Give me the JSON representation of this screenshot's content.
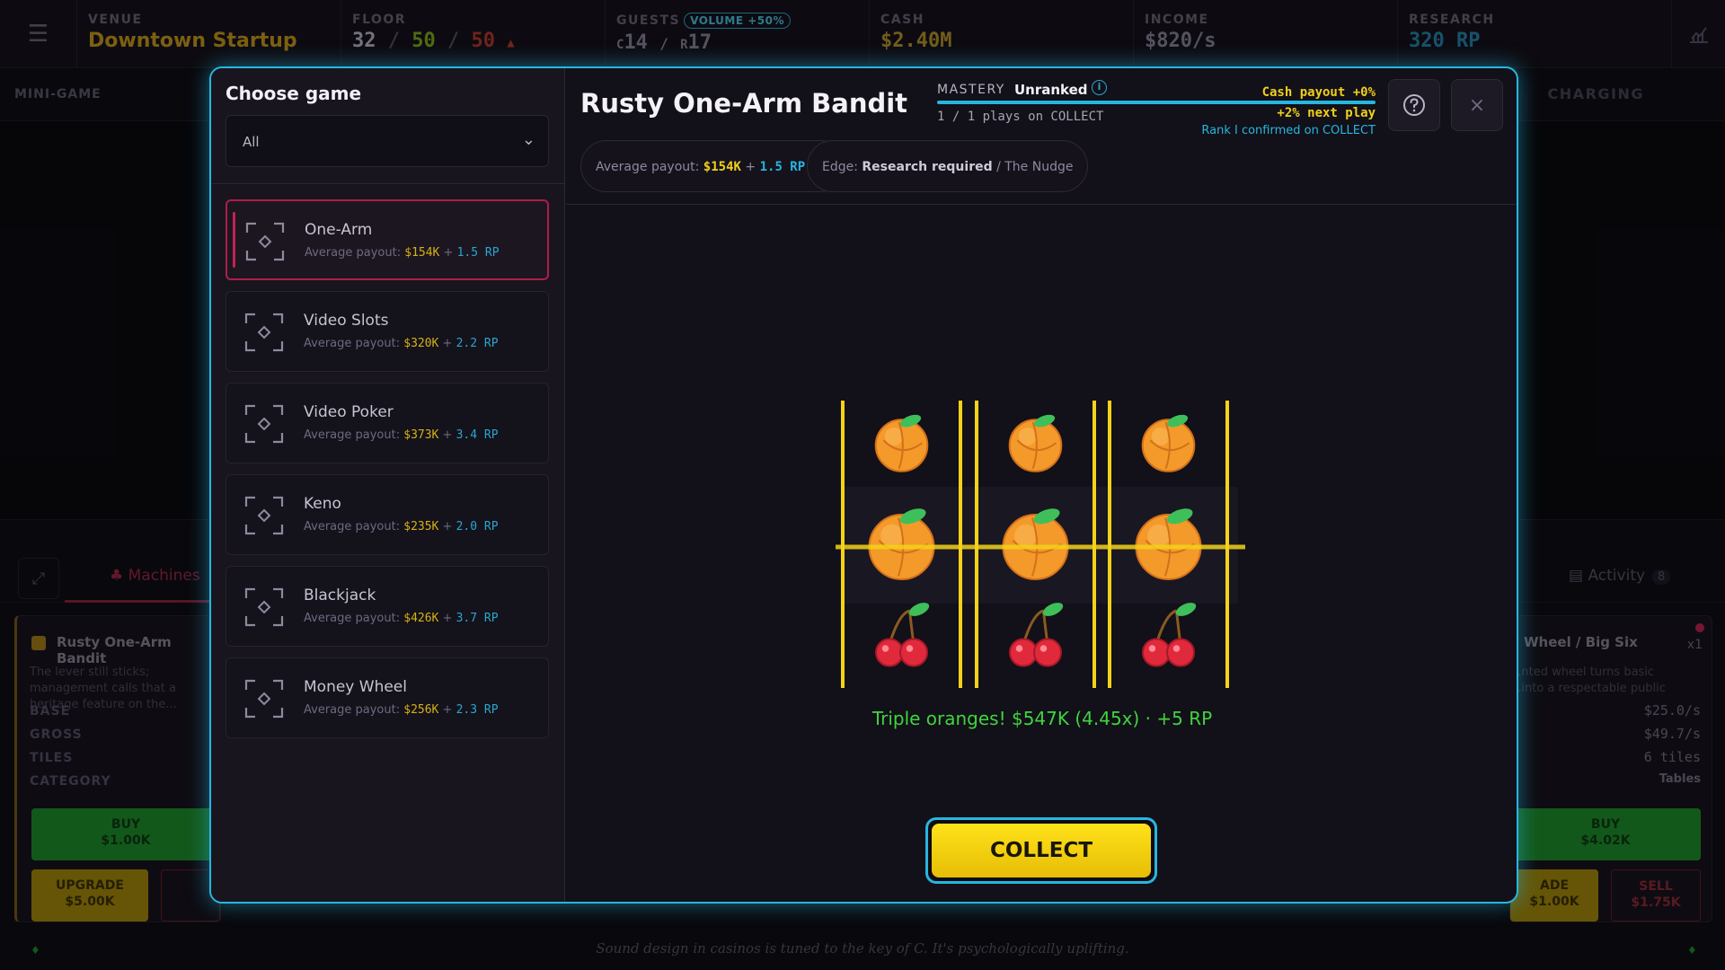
{
  "topbar": {
    "venue_label": "VENUE",
    "venue_name": "Downtown Startup",
    "floor_label": "FLOOR",
    "floor_used": "32",
    "floor_mid": "50",
    "floor_max": "50",
    "guests_label": "GUESTS",
    "guests_chip": "VOLUME +50%",
    "guests_c_label": "C",
    "guests_c": "14",
    "guests_r_label": "R",
    "guests_r": "17",
    "cash_label": "CASH",
    "cash_value": "$2.40M",
    "income_label": "INCOME",
    "income_value": "$820/s",
    "research_label": "RESEARCH",
    "research_value": "320 RP"
  },
  "subbar": {
    "left": "MINI-GAME",
    "right": "CHARGING"
  },
  "bottom": {
    "tab_machines": "Machines",
    "tab_activity": "Activity",
    "activity_count": "8",
    "left_card": {
      "title": "Rusty One-Arm Bandit",
      "desc": "The lever still sticks; management calls that a heritage feature on the...",
      "base": "BASE",
      "gross": "GROSS",
      "tiles": "TILES",
      "category": "CATEGORY",
      "buy": "BUY",
      "buy_price": "$1.00K",
      "upgrade": "UPGRADE",
      "upgrade_price": "$5.00K"
    },
    "right_card": {
      "title": "y Wheel / Big Six",
      "count": "x1",
      "desc": "...nted wheel turns basic ...into a respectable public",
      "v1": "$25.0/s",
      "v2": "$49.7/s",
      "v3": "6 tiles",
      "v4": "Tables",
      "buy": "BUY",
      "buy_price": "$4.02K",
      "upgrade": "ADE",
      "upgrade_price": "$1.00K",
      "sell": "SELL",
      "sell_price": "$1.75K"
    },
    "tip": "Sound design in casinos is tuned to the key of C. It's psychologically uplifting."
  },
  "modal": {
    "side_title": "Choose game",
    "filter_value": "All",
    "games": [
      {
        "name": "One-Arm",
        "payout_label": "Average payout:",
        "cash": "$154K",
        "plus": "+",
        "rp": "1.5 RP"
      },
      {
        "name": "Video Slots",
        "payout_label": "Average payout:",
        "cash": "$320K",
        "plus": "+",
        "rp": "2.2 RP"
      },
      {
        "name": "Video Poker",
        "payout_label": "Average payout:",
        "cash": "$373K",
        "plus": "+",
        "rp": "3.4 RP"
      },
      {
        "name": "Keno",
        "payout_label": "Average payout:",
        "cash": "$235K",
        "plus": "+",
        "rp": "2.0 RP"
      },
      {
        "name": "Blackjack",
        "payout_label": "Average payout:",
        "cash": "$426K",
        "plus": "+",
        "rp": "3.7 RP"
      },
      {
        "name": "Money Wheel",
        "payout_label": "Average payout:",
        "cash": "$256K",
        "plus": "+",
        "rp": "2.3 RP"
      }
    ],
    "title": "Rusty One-Arm Bandit",
    "mastery_label": "MASTERY",
    "mastery_rank": "Unranked",
    "mastery_progress": 1.0,
    "plays": "1 / 1 plays on COLLECT",
    "cash_payout": "Cash payout +0%",
    "next_play": "+2% next play",
    "rank_confirm": "Rank I confirmed on COLLECT",
    "avg_label": "Average payout:",
    "avg_cash": "$154K",
    "avg_plus": "+",
    "avg_rp": "1.5 RP",
    "edge_label": "Edge:",
    "edge_value": "Research required",
    "edge_extra": "/ The Nudge",
    "reels": [
      [
        "orange",
        "orange",
        "cherry"
      ],
      [
        "orange",
        "orange",
        "cherry"
      ],
      [
        "orange",
        "orange",
        "cherry"
      ]
    ],
    "result_text": "Triple oranges!  $547K (4.45x)  ·  +5 RP",
    "collect_label": "COLLECT",
    "colors": {
      "accent": "#27b6e0",
      "cash": "#f0cf1c",
      "rp": "#27b6e0",
      "win": "#3fd43f",
      "active": "#b01d49"
    }
  }
}
